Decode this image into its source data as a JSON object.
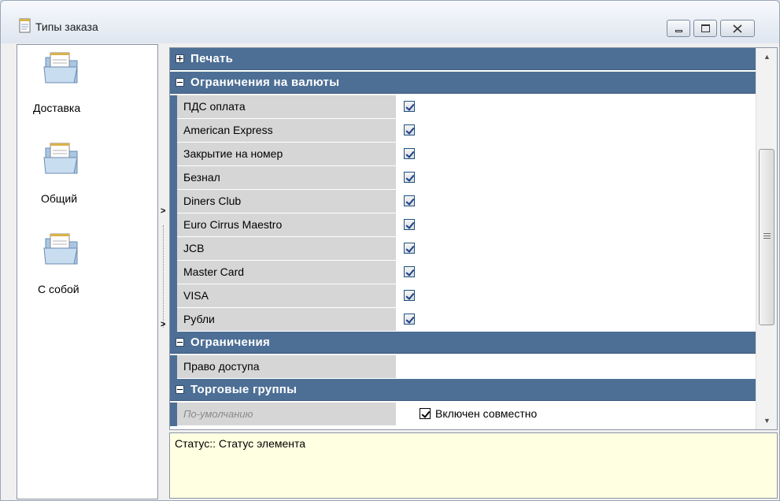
{
  "window": {
    "title": "Типы заказа",
    "icons": {
      "app": "notepad-icon",
      "minimize": "minimize-icon",
      "maximize": "restore-icon",
      "close": "close-icon"
    }
  },
  "left_panel": {
    "items": [
      {
        "label": "Доставка",
        "icon": "folder-icon"
      },
      {
        "label": "Общий",
        "icon": "folder-icon"
      },
      {
        "label": "С собой",
        "icon": "folder-icon"
      }
    ]
  },
  "property_grid": {
    "categories": {
      "print": {
        "label": "Печать",
        "expanded": false
      },
      "currency": {
        "label": "Ограничения на валюты",
        "expanded": true
      },
      "restrictions": {
        "label": "Ограничения",
        "expanded": true
      },
      "trade_groups": {
        "label": "Торговые группы",
        "expanded": true
      }
    },
    "currency_rows": [
      {
        "name": "ПДС оплата",
        "checked": true
      },
      {
        "name": "American Express",
        "checked": true
      },
      {
        "name": "Закрытие на номер",
        "checked": true
      },
      {
        "name": "Безнал",
        "checked": true
      },
      {
        "name": "Diners Club",
        "checked": true
      },
      {
        "name": "Euro Cirrus Maestro",
        "checked": true
      },
      {
        "name": "JCB",
        "checked": true
      },
      {
        "name": "Master Card",
        "checked": true
      },
      {
        "name": "VISA",
        "checked": true
      },
      {
        "name": "Рубли",
        "checked": true
      }
    ],
    "access_row": {
      "name": "Право доступа",
      "value": ""
    },
    "default_row": {
      "name": "По-умолчанию",
      "value": "Включен совместно",
      "checked": true
    }
  },
  "status": {
    "text": "Статус:: Статус элемента"
  },
  "colors": {
    "category_header": "#4d6f95",
    "status_bg": "#ffffe1",
    "name_cell": "#d6d6d6"
  }
}
